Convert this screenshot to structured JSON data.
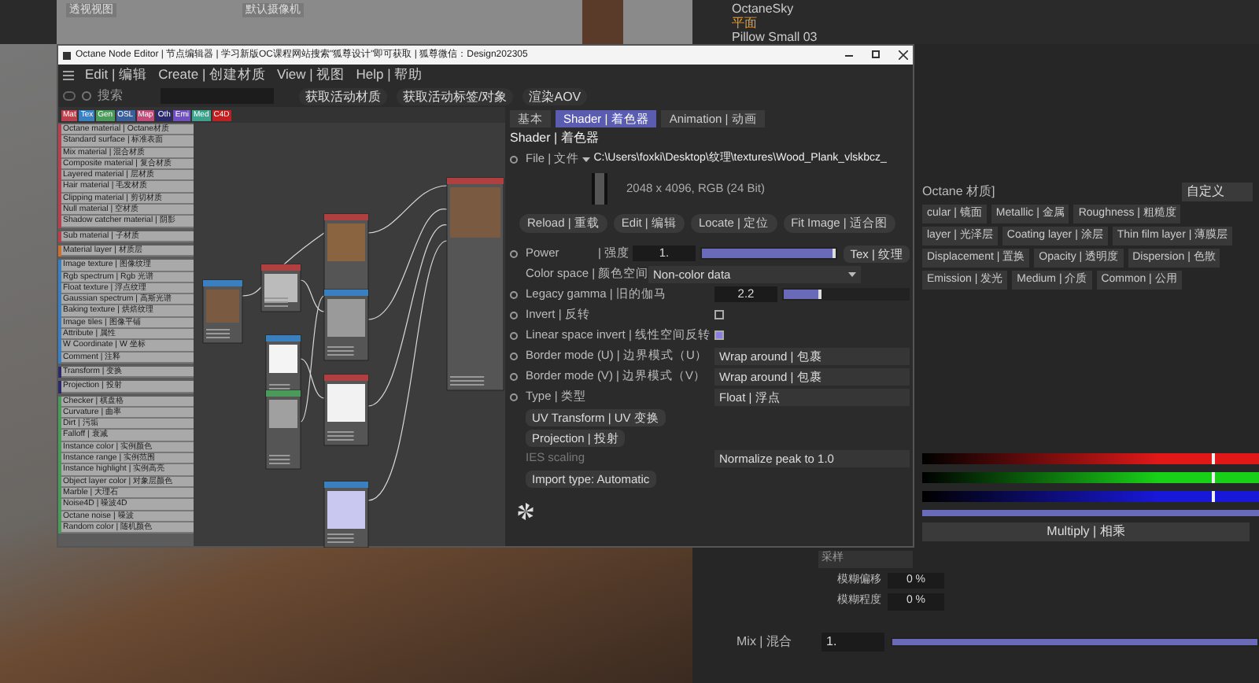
{
  "viewport": {
    "labels": [
      "透视视图",
      "默认摄像机"
    ]
  },
  "object_list": [
    {
      "name": "OctaneSky",
      "selected": false
    },
    {
      "name": "平面",
      "selected": true
    },
    {
      "name": "Pillow Small 03",
      "selected": false
    }
  ],
  "node_editor": {
    "title": "Octane Node Editor | 节点编辑器 | 学习新版OC课程网站搜索\"狐尊设计\"即可获取 | 狐尊微信：Design202305",
    "menu": [
      "Edit | 编辑",
      "Create | 创建材质",
      "View | 视图",
      "Help | 帮助"
    ],
    "search": {
      "placeholder": "搜索"
    },
    "toolbar_buttons": [
      "获取活动材质",
      "获取活动标签/对象",
      "渲染AOV"
    ],
    "filter_tags": [
      {
        "label": "Mat",
        "color": "#b8404c"
      },
      {
        "label": "Tex",
        "color": "#3a7fc0"
      },
      {
        "label": "Gen",
        "color": "#4a9a5a"
      },
      {
        "label": "OSL",
        "color": "#3a5f9a"
      },
      {
        "label": "Map",
        "color": "#c04a7a"
      },
      {
        "label": "Oth",
        "color": "#2a2a6a"
      },
      {
        "label": "Emi",
        "color": "#7050c0"
      },
      {
        "label": "Med",
        "color": "#3fa08c"
      },
      {
        "label": "C4D",
        "color": "#c02020"
      }
    ],
    "node_groups": [
      {
        "color": "#b8404c",
        "items": [
          "Octane material | Octane材质",
          "Standard surface | 标准表面",
          "Mix material | 混合材质",
          "Composite material | 复合材质",
          "Layered material | 层材质",
          "Hair material | 毛发材质",
          "Clipping material | 剪切材质",
          "Null material | 空材质",
          "Shadow catcher material | 阴影"
        ]
      },
      {
        "color": "#b8404c",
        "items": [
          "Sub material | 子材质"
        ]
      },
      {
        "color": "#d07030",
        "items": [
          "Material layer | 材质层"
        ]
      },
      {
        "color": "#3a7fc0",
        "items": [
          "Image texture | 图像纹理",
          "Rgb spectrum | Rgb 光谱",
          "Float texture | 浮点纹理",
          "Gaussian spectrum | 高斯光谱",
          "Baking texture | 烘焙纹理",
          "Image tiles | 图像平铺",
          "Attribute | 属性",
          "W Coordinate | W 坐标",
          "Comment | 注释"
        ]
      },
      {
        "color": "#2a2a6a",
        "items": [
          "Transform | 变换"
        ]
      },
      {
        "color": "#2a2a6a",
        "items": [
          "Projection | 投射"
        ]
      },
      {
        "color": "#4a9a5a",
        "items": [
          "Checker | 棋盘格",
          "Curvature | 曲率",
          "Dirt | 污垢",
          "Falloff | 衰减",
          "Instance color | 实例颜色",
          "Instance range | 实例范围",
          "Instance highlight | 实例高亮",
          "Object layer color | 对象层颜色",
          "Marble | 大理石",
          "Noise4D | 噪波4D",
          "Octane noise | 噪波",
          "Random color | 随机颜色"
        ]
      }
    ],
    "properties": {
      "tabs": [
        {
          "label": "基本",
          "selected": false
        },
        {
          "label": "Shader | 着色器",
          "selected": true
        },
        {
          "label": "Animation | 动画",
          "selected": false
        }
      ],
      "heading": "Shader | 着色器",
      "file": {
        "label": "File | 文件",
        "path": "C:\\Users\\foxki\\Desktop\\纹理\\textures\\Wood_Plank_vlskbcz_"
      },
      "image_info": "2048 x 4096, RGB (24 Bit)",
      "file_buttons": [
        "Reload | 重载",
        "Edit | 编辑",
        "Locate | 定位",
        "Fit Image | 适合图"
      ],
      "rows": [
        {
          "kind": "slider",
          "label": "Power",
          "sublabel": "| 强度",
          "value": "1.",
          "level": 1,
          "button": "Tex | 纹理",
          "animatable": true
        },
        {
          "kind": "dropdown",
          "label": "Color space | 颜色空间",
          "value": "Non-color data",
          "animatable": false
        },
        {
          "kind": "slider",
          "label": "Legacy gamma | 旧的伽马",
          "value": "2.2",
          "level": 0.3,
          "animatable": true
        },
        {
          "kind": "checkbox",
          "label": "Invert | 反转",
          "checked": false,
          "animatable": true
        },
        {
          "kind": "checkbox",
          "label": "Linear space invert | 线性空间反转",
          "checked": true,
          "animatable": true
        },
        {
          "kind": "select",
          "label": "Border mode (U) | 边界模式（U）",
          "value": "Wrap around | 包裹",
          "animatable": true
        },
        {
          "kind": "select",
          "label": "Border mode (V) | 边界模式（V）",
          "value": "Wrap around | 包裹",
          "animatable": true
        },
        {
          "kind": "select",
          "label": "Type | 类型",
          "value": "Float | 浮点",
          "animatable": true
        },
        {
          "kind": "button",
          "label": "UV Transform | UV 变换",
          "animatable": false
        },
        {
          "kind": "button",
          "label": "Projection | 投射",
          "animatable": false
        },
        {
          "kind": "select",
          "label": "IES scaling",
          "value": "Normalize peak to 1.0",
          "disabled": true,
          "animatable": false
        },
        {
          "kind": "button",
          "label": "Import type: Automatic",
          "animatable": false
        }
      ]
    }
  },
  "material_panel": {
    "title": "Octane 材质]",
    "preset": "自定义",
    "channel_buttons": [
      [
        "cular | 镜面",
        "Metallic | 金属",
        "Roughness | 粗糙度"
      ],
      [
        "layer | 光泽层",
        "Coating layer | 涂层",
        "Thin film layer | 薄膜层"
      ],
      [
        "Displacement | 置换",
        "Opacity | 透明度",
        "Dispersion | 色散"
      ],
      [
        "Emission | 发光",
        "Medium | 介质",
        "Common | 公用"
      ]
    ],
    "color_sliders": [
      {
        "color": "#e01818",
        "level": 0.86
      },
      {
        "color": "#18d018",
        "level": 0.86
      },
      {
        "color": "#1818d8",
        "level": 0.86
      }
    ],
    "blend_mode": "Multiply | 相乘",
    "sampling": "采样",
    "params": [
      {
        "label": "模糊偏移",
        "value": "0 %"
      },
      {
        "label": "模糊程度",
        "value": "0 %"
      }
    ],
    "mix": {
      "label": "Mix | 混合",
      "value": "1.",
      "level": 1
    }
  }
}
